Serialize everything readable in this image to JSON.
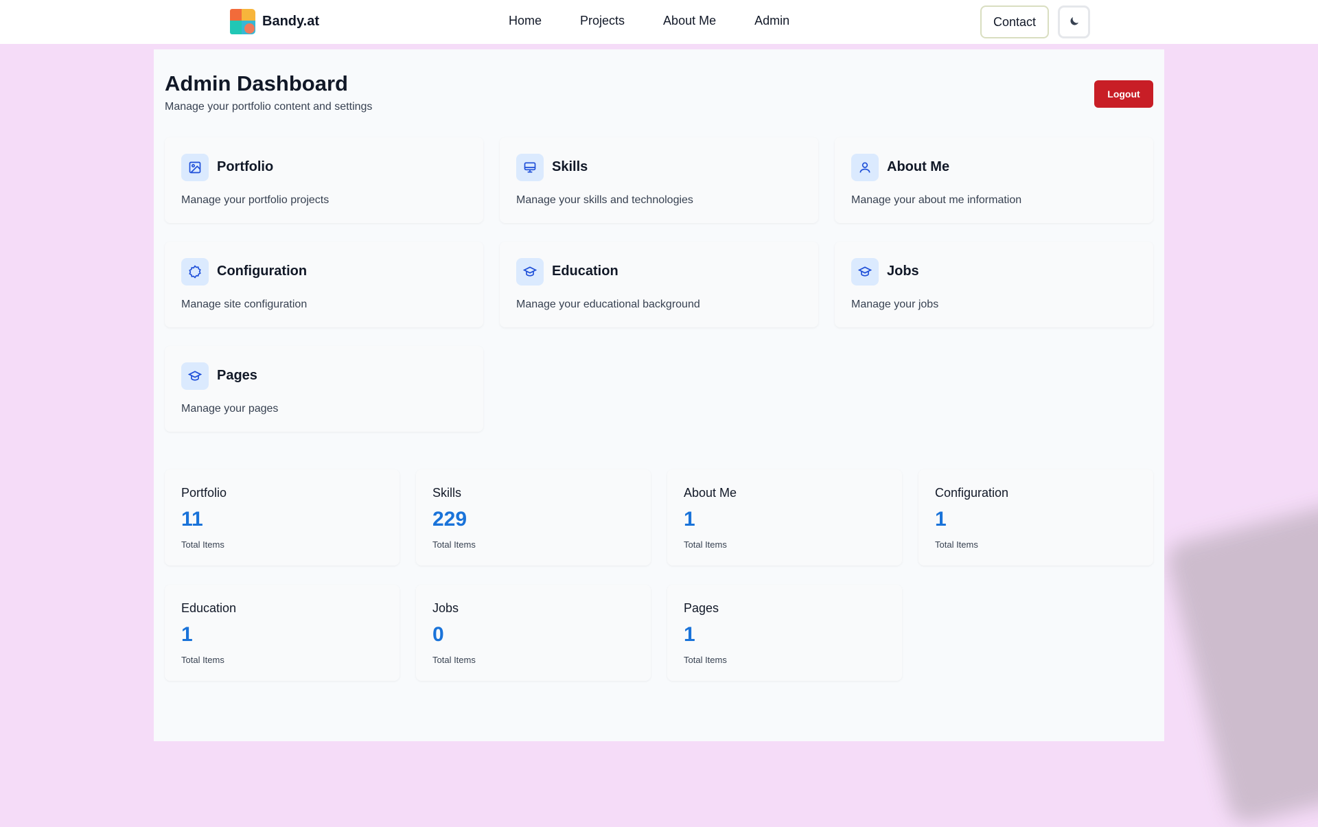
{
  "nav": {
    "brand": "Bandy.at",
    "links": [
      "Home",
      "Projects",
      "About Me",
      "Admin"
    ],
    "contact": "Contact",
    "theme_toggle_icon": "moon-icon"
  },
  "header": {
    "title": "Admin Dashboard",
    "subtitle": "Manage your portfolio content and settings",
    "logout": "Logout",
    "logout_color": "#c81e26"
  },
  "cards": [
    {
      "title": "Portfolio",
      "desc": "Manage your portfolio projects",
      "icon": "image-icon"
    },
    {
      "title": "Skills",
      "desc": "Manage your skills and technologies",
      "icon": "monitor-icon"
    },
    {
      "title": "About Me",
      "desc": "Manage your about me information",
      "icon": "user-icon"
    },
    {
      "title": "Configuration",
      "desc": "Manage site configuration",
      "icon": "gear-icon"
    },
    {
      "title": "Education",
      "desc": "Manage your educational background",
      "icon": "graduation-cap-icon"
    },
    {
      "title": "Jobs",
      "desc": "Manage your jobs",
      "icon": "graduation-cap-icon"
    },
    {
      "title": "Pages",
      "desc": "Manage your pages",
      "icon": "graduation-cap-icon"
    }
  ],
  "stats": [
    {
      "label": "Portfolio",
      "value": "11",
      "sub": "Total Items"
    },
    {
      "label": "Skills",
      "value": "229",
      "sub": "Total Items"
    },
    {
      "label": "About Me",
      "value": "1",
      "sub": "Total Items"
    },
    {
      "label": "Configuration",
      "value": "1",
      "sub": "Total Items"
    },
    {
      "label": "Education",
      "value": "1",
      "sub": "Total Items"
    },
    {
      "label": "Jobs",
      "value": "0",
      "sub": "Total Items"
    },
    {
      "label": "Pages",
      "value": "1",
      "sub": "Total Items"
    }
  ],
  "colors": {
    "page_background": "#f5dcf8",
    "accent": "#1a73d9",
    "icon_background": "#dbeafe"
  }
}
